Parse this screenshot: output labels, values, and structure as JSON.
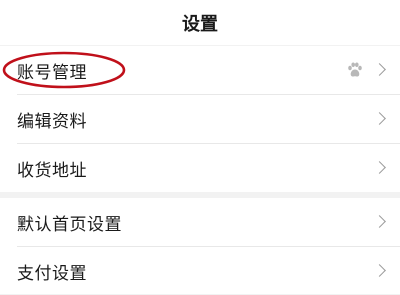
{
  "header": {
    "title": "设置"
  },
  "groups": [
    {
      "rows": [
        {
          "label": "账号管理",
          "icon": "paw-icon"
        },
        {
          "label": "编辑资料"
        },
        {
          "label": "收货地址"
        }
      ]
    },
    {
      "rows": [
        {
          "label": "默认首页设置"
        },
        {
          "label": "支付设置"
        }
      ]
    }
  ],
  "colors": {
    "annotation": "#c0101a",
    "background": "#f2f2f2",
    "chevron": "#9a9a9a"
  }
}
